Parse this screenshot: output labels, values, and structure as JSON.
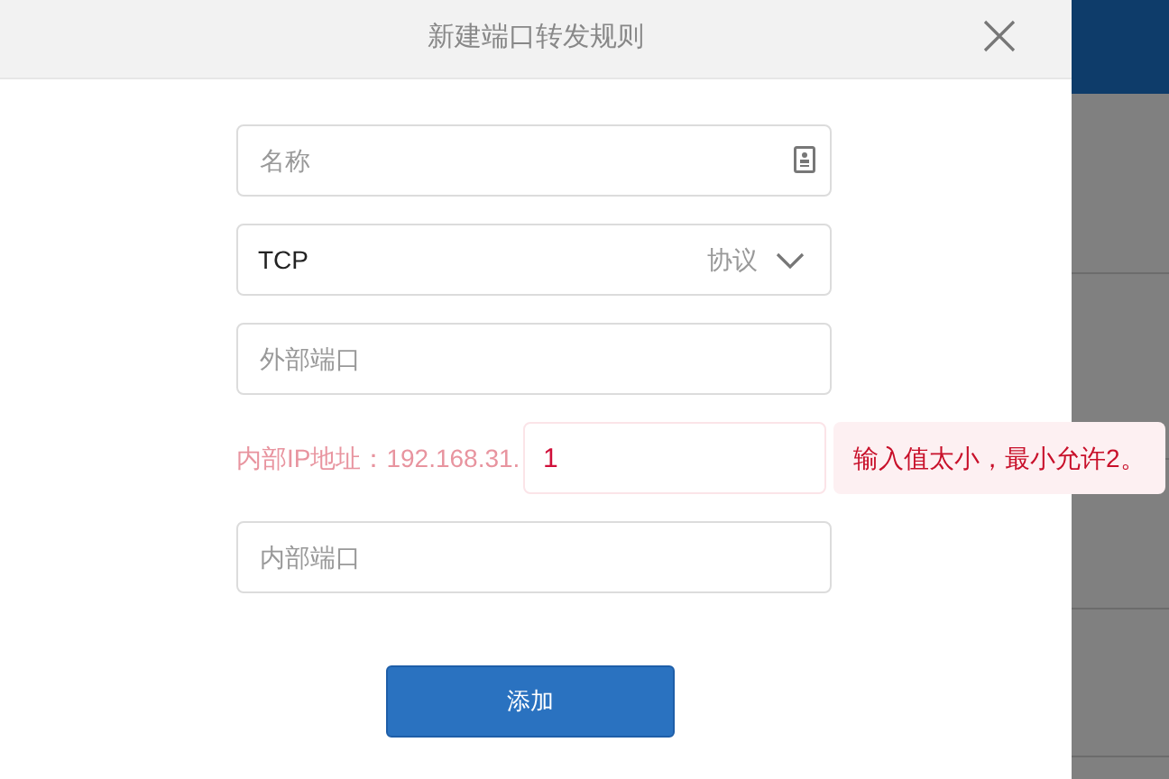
{
  "dialog": {
    "title": "新建端口转发规则"
  },
  "fields": [
    {
      "kind": "text_with_icon",
      "placeholder": "名称"
    },
    {
      "kind": "select",
      "value": "TCP",
      "label": "协议"
    },
    {
      "kind": "text",
      "placeholder": "外部端口"
    },
    {
      "kind": "prefixed",
      "prefix": "内部IP地址：192.168.31.",
      "value": "1",
      "error": "输入值太小，最小允许2。"
    },
    {
      "kind": "text",
      "placeholder": "内部端口"
    }
  ],
  "submit": "添加"
}
